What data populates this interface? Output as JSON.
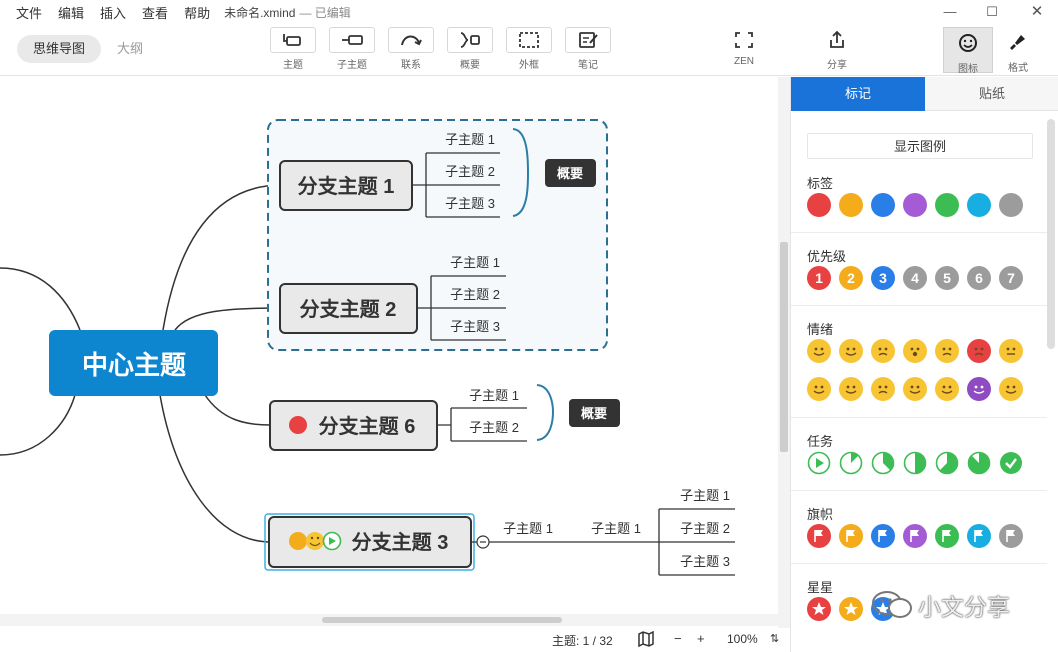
{
  "menu": {
    "items": [
      {
        "name": "menu-file",
        "label": "文件"
      },
      {
        "name": "menu-edit",
        "label": "编辑"
      },
      {
        "name": "menu-insert",
        "label": "插入"
      },
      {
        "name": "menu-view",
        "label": "查看"
      },
      {
        "name": "menu-help",
        "label": "帮助"
      }
    ],
    "doc_title": "未命名.xmind",
    "doc_status": "— 已编辑"
  },
  "toolbar": {
    "view_tabs": [
      {
        "label": "思维导图",
        "active": true
      },
      {
        "label": "大纲",
        "active": false
      }
    ],
    "tools": [
      {
        "name": "topic",
        "label": "主题",
        "icon": "topic-icon"
      },
      {
        "name": "subtopic",
        "label": "子主题",
        "icon": "subtopic-icon"
      },
      {
        "name": "relationship",
        "label": "联系",
        "icon": "relationship-icon"
      },
      {
        "name": "summary",
        "label": "概要",
        "icon": "summary-icon"
      },
      {
        "name": "boundary",
        "label": "外框",
        "icon": "boundary-icon"
      },
      {
        "name": "note",
        "label": "笔记",
        "icon": "note-icon"
      },
      {
        "name": "zen",
        "label": "ZEN",
        "icon": "zen-icon"
      },
      {
        "name": "share",
        "label": "分享",
        "icon": "share-icon"
      }
    ],
    "right_tools": [
      {
        "name": "icon-panel",
        "label": "图标",
        "icon": "smiley-icon",
        "active": true
      },
      {
        "name": "format-panel",
        "label": "格式",
        "icon": "brush-icon",
        "active": false
      }
    ]
  },
  "mindmap": {
    "central": "中心主题",
    "branch1": {
      "title": "分支主题 1",
      "subs": [
        "子主题 1",
        "子主题 2",
        "子主题 3"
      ],
      "summary": "概要"
    },
    "branch2": {
      "title": "分支主题 2",
      "subs": [
        "子主题 1",
        "子主题 2",
        "子主题 3"
      ]
    },
    "branch6": {
      "title": "分支主题 6",
      "subs": [
        "子主题 1",
        "子主题 2"
      ],
      "summary": "概要",
      "marker": "red-label-icon"
    },
    "branch3": {
      "title": "分支主题 3",
      "sub": "子主题 1",
      "subsub": "子主题 1",
      "leaves": [
        "子主题 1",
        "子主题 2",
        "子主题 3"
      ],
      "markers": [
        "orange-label-icon",
        "happy-face-icon",
        "task-start-icon"
      ]
    },
    "colors": {
      "central": "#0d86cf",
      "boundary": "#2b6f92",
      "summary": "#333333",
      "line": "#333333",
      "selected": "#3db1e0"
    }
  },
  "status": {
    "topic_count": "主题: 1 / 32",
    "zoom": "100%"
  },
  "panel": {
    "tabs": [
      {
        "label": "标记",
        "active": true
      },
      {
        "label": "贴纸",
        "active": false
      }
    ],
    "legend_button": "显示图例",
    "sections": {
      "labels": {
        "title": "标签",
        "colors": [
          "#e84141",
          "#f4ac1b",
          "#2a7ee8",
          "#a55bd6",
          "#3bbd54",
          "#18aee2",
          "#9c9c9c"
        ]
      },
      "priority": {
        "title": "优先级",
        "items": [
          "1",
          "2",
          "3",
          "4",
          "5",
          "6",
          "7"
        ],
        "colors": [
          "#e84141",
          "#f4ac1b",
          "#2a7ee8",
          "#9c9c9c",
          "#9c9c9c",
          "#9c9c9c",
          "#9c9c9c"
        ]
      },
      "mood": {
        "title": "情绪",
        "faces": [
          "grin-face-icon",
          "smile-face-icon",
          "cry-face-icon",
          "shock-face-icon",
          "sad-face-icon",
          "angry-face-icon",
          "neutral-face-icon",
          "think-face-icon",
          "kiss-face-icon",
          "confused-face-icon",
          "laugh-face-icon",
          "love-face-icon",
          "devil-face-icon",
          "squint-face-icon"
        ]
      },
      "task": {
        "title": "任务",
        "progress": [
          0,
          0.125,
          0.375,
          0.5,
          0.625,
          0.875,
          1
        ]
      },
      "flags": {
        "title": "旗帜",
        "colors": [
          "#e84141",
          "#f4ac1b",
          "#2a7ee8",
          "#a55bd6",
          "#3bbd54",
          "#18aee2",
          "#9c9c9c"
        ]
      },
      "stars": {
        "title": "星星",
        "colors": [
          "#e84141",
          "#f4ac1b",
          "#2a7ee8"
        ]
      }
    }
  },
  "watermark": "小文分享"
}
